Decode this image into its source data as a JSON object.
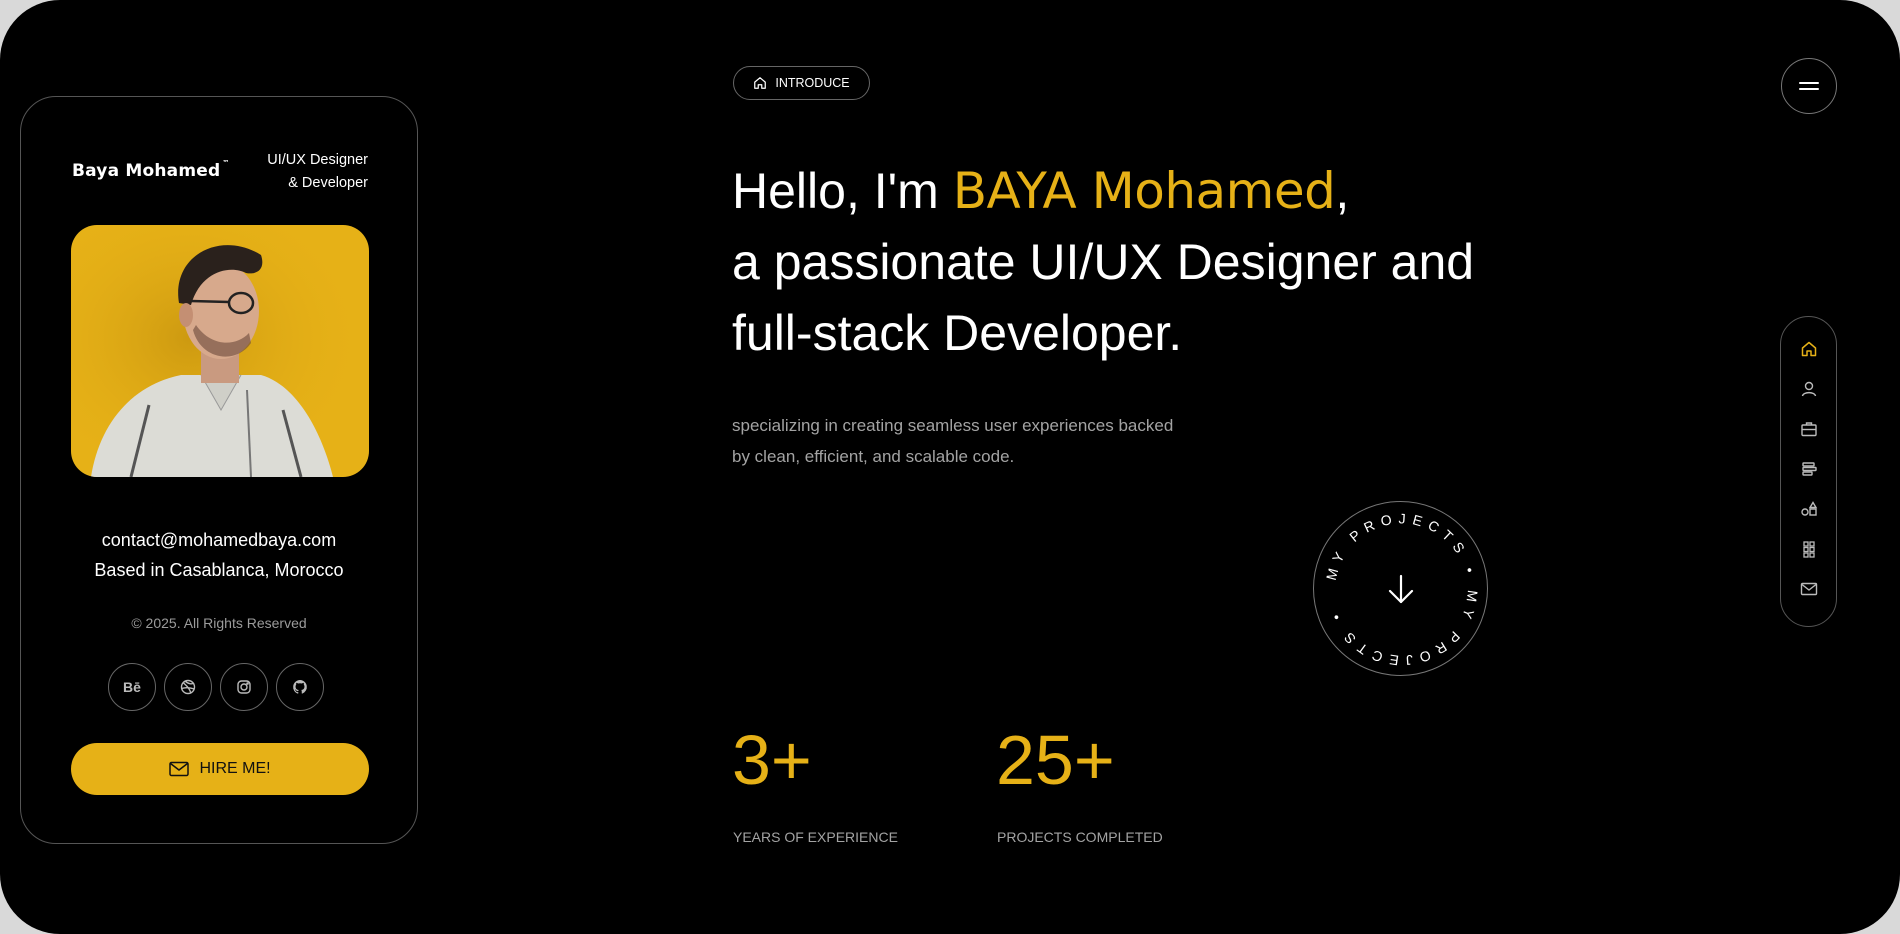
{
  "profile": {
    "brand": "Baya Mohamed",
    "brand_mark": "™",
    "role_line1": "UI/UX Designer",
    "role_line2": "& Developer",
    "email": "contact@mohamedbaya.com",
    "location": "Based in Casablanca, Morocco",
    "copyright": "© 2025. All Rights Reserved",
    "socials": [
      {
        "name": "behance",
        "label": "Bē"
      },
      {
        "name": "dribbble",
        "label": ""
      },
      {
        "name": "instagram",
        "label": ""
      },
      {
        "name": "github",
        "label": ""
      }
    ],
    "hire_label": "HIRE ME!"
  },
  "intro": {
    "pill_label": "INTRODUCE",
    "headline_prefix": "Hello, I'm ",
    "headline_name": "BAYA Mohamed",
    "headline_comma": ",",
    "headline_line2": "a passionate UI/UX Designer and",
    "headline_line3": "full-stack Developer.",
    "subtitle_line1": "specializing in creating seamless user experiences backed",
    "subtitle_line2": "by clean, efficient, and scalable code.",
    "projects_ring_text": "MY PROJECTS • MY PROJECTS • "
  },
  "stats": [
    {
      "value": "3+",
      "label": "YEARS OF EXPERIENCE"
    },
    {
      "value": "25+",
      "label": "PROJECTS COMPLETED"
    }
  ],
  "sidenav": {
    "items": [
      "home-icon",
      "user-icon",
      "briefcase-icon",
      "align-left-icon",
      "shapes-icon",
      "grid-icon",
      "mail-icon"
    ],
    "active": "home-icon"
  },
  "colors": {
    "accent": "#e6b117",
    "background": "#000000",
    "muted_text": "#a3a3a3"
  }
}
